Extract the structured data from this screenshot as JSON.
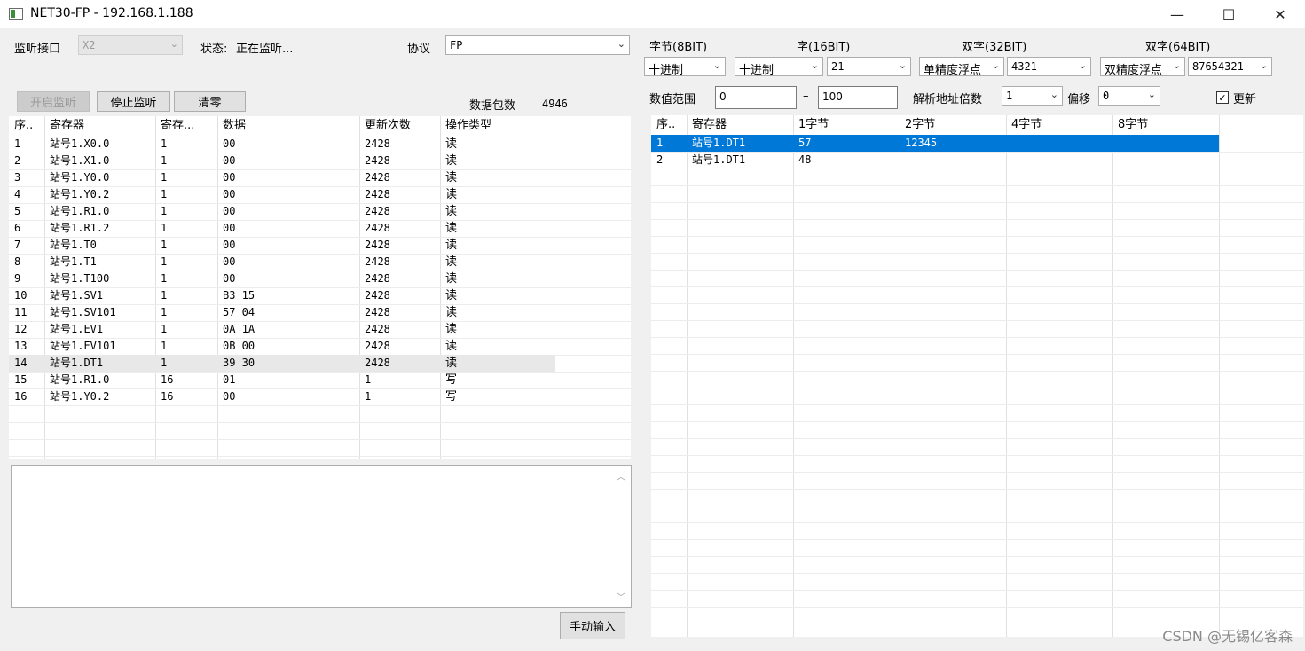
{
  "window": {
    "title": "NET30-FP - 192.168.1.188",
    "minimize_glyph": "—",
    "maximize_glyph": "☐",
    "close_glyph": "✕"
  },
  "left": {
    "port_label": "监听接口",
    "port_value": "X2",
    "status_label": "状态:",
    "status_value": "正在监听...",
    "protocol_label": "协议",
    "protocol_value": "FP",
    "start_button": "开启监听",
    "stop_button": "停止监听",
    "clear_button": "清零",
    "packet_count_label": "数据包数",
    "packet_count_value": "4946",
    "columns": [
      "序..",
      "寄存器",
      "寄存...",
      "数据",
      "更新次数",
      "操作类型"
    ],
    "rows": [
      [
        "1",
        "站号1.X0.0",
        "1",
        "00",
        "2428",
        "读"
      ],
      [
        "2",
        "站号1.X1.0",
        "1",
        "00",
        "2428",
        "读"
      ],
      [
        "3",
        "站号1.Y0.0",
        "1",
        "00",
        "2428",
        "读"
      ],
      [
        "4",
        "站号1.Y0.2",
        "1",
        "00",
        "2428",
        "读"
      ],
      [
        "5",
        "站号1.R1.0",
        "1",
        "00",
        "2428",
        "读"
      ],
      [
        "6",
        "站号1.R1.2",
        "1",
        "00",
        "2428",
        "读"
      ],
      [
        "7",
        "站号1.T0",
        "1",
        "00",
        "2428",
        "读"
      ],
      [
        "8",
        "站号1.T1",
        "1",
        "00",
        "2428",
        "读"
      ],
      [
        "9",
        "站号1.T100",
        "1",
        "00",
        "2428",
        "读"
      ],
      [
        "10",
        "站号1.SV1",
        "1",
        "B3 15",
        "2428",
        "读"
      ],
      [
        "11",
        "站号1.SV101",
        "1",
        "57 04",
        "2428",
        "读"
      ],
      [
        "12",
        "站号1.EV1",
        "1",
        "0A 1A",
        "2428",
        "读"
      ],
      [
        "13",
        "站号1.EV101",
        "1",
        "0B 00",
        "2428",
        "读"
      ],
      [
        "14",
        "站号1.DT1",
        "1",
        "39 30",
        "2428",
        "读"
      ],
      [
        "15",
        "站号1.R1.0",
        "16",
        "01",
        "1",
        "写"
      ],
      [
        "16",
        "站号1.Y0.2",
        "16",
        "00",
        "1",
        "写"
      ]
    ],
    "manual_input_button": "手动输入",
    "log_text": ""
  },
  "right": {
    "byte_label": "字节(8BIT)",
    "word_label": "字(16BIT)",
    "dword_label": "双字(32BIT)",
    "qword_label": "双字(64BIT)",
    "byte_format": "十进制",
    "word_format": "十进制",
    "word_order": "21",
    "dword_format": "单精度浮点",
    "dword_order": "4321",
    "qword_format": "双精度浮点",
    "qword_order": "87654321",
    "range_label": "数值范围",
    "range_min": "0",
    "range_sep": "–",
    "range_max": "100",
    "multiple_label": "解析地址倍数",
    "multiple_value": "1",
    "offset_label": "偏移",
    "offset_value": "0",
    "update_label": "更新",
    "update_checked": true,
    "columns": [
      "序..",
      "寄存器",
      "1字节",
      "2字节",
      "4字节",
      "8字节"
    ],
    "rows": [
      [
        "1",
        "站号1.DT1",
        "57",
        "12345",
        "",
        ""
      ],
      [
        "2",
        "站号1.DT1",
        "48",
        "",
        "",
        ""
      ]
    ]
  },
  "watermark": "CSDN @无锡亿客森"
}
